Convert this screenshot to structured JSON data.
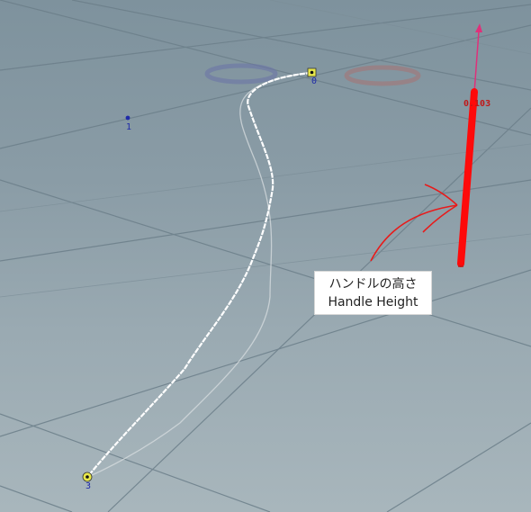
{
  "viewport": {
    "points": [
      {
        "id": "0",
        "label": "0",
        "selected": true
      },
      {
        "id": "1",
        "label": "1",
        "selected": false
      },
      {
        "id": "3",
        "label": "3",
        "selected": true
      }
    ],
    "handle": {
      "value_label": "0.103",
      "color": "#ff0a0a",
      "arrow_color": "#e0307a"
    },
    "annotation": {
      "line_jp": "ハンドルの高さ",
      "line_en": "Handle Height"
    },
    "colors": {
      "point_highlight": "#e8e84a",
      "point_blue": "#1f2aa8",
      "curve": "#ffffff"
    }
  }
}
